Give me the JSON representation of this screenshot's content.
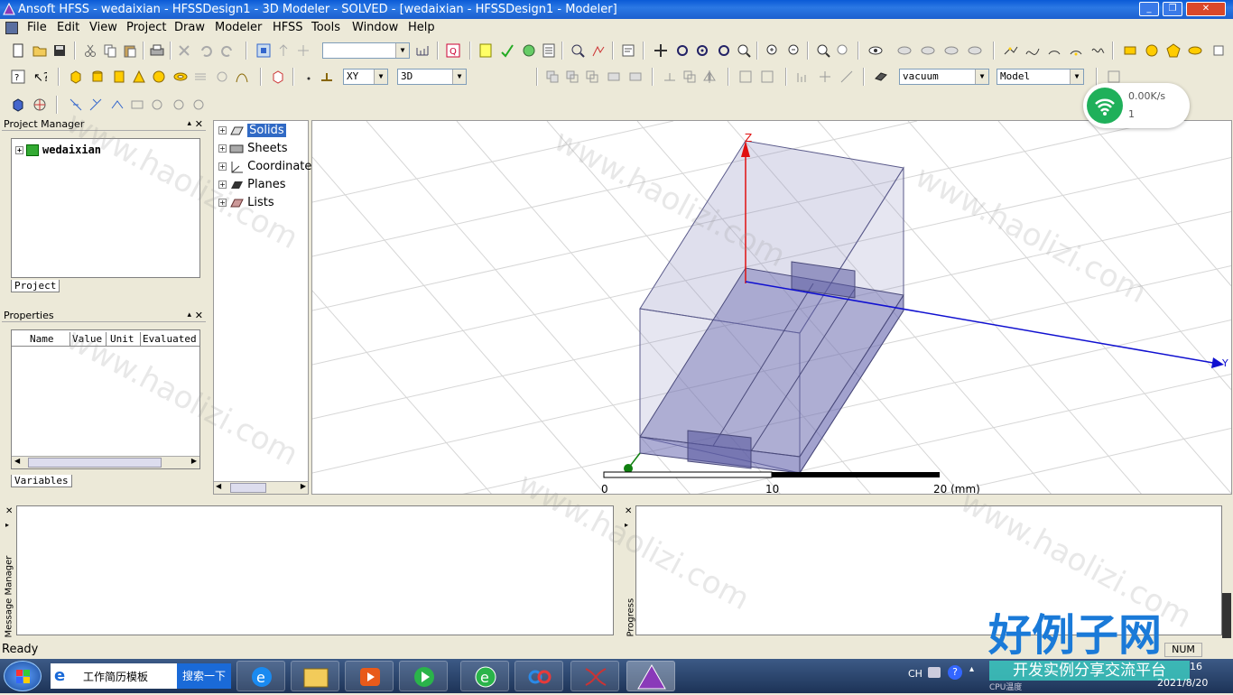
{
  "window": {
    "title": "Ansoft HFSS  - wedaixian - HFSSDesign1 - 3D Modeler - SOLVED - [wedaixian - HFSSDesign1 - Modeler]"
  },
  "menu": [
    "File",
    "Edit",
    "View",
    "Project",
    "Draw",
    "Modeler",
    "HFSS",
    "Tools",
    "Window",
    "Help"
  ],
  "toolbar": {
    "plane": "XY",
    "dim": "3D",
    "material": "vacuum",
    "model": "Model",
    "blank_combo": ""
  },
  "project_manager": {
    "title": "Project Manager",
    "project": "wedaixian",
    "tab": "Project"
  },
  "properties": {
    "title": "Properties",
    "columns": [
      "Name",
      "Value",
      "Unit",
      "Evaluated"
    ],
    "tab": "Variables"
  },
  "model_tree": [
    {
      "label": "Solids",
      "icon": "solids-icon",
      "selected": true
    },
    {
      "label": "Sheets",
      "icon": "sheets-icon",
      "selected": false
    },
    {
      "label": "Coordinate",
      "icon": "coordinate-icon",
      "selected": false
    },
    {
      "label": "Planes",
      "icon": "planes-icon",
      "selected": false
    },
    {
      "label": "Lists",
      "icon": "lists-icon",
      "selected": false
    }
  ],
  "viewport": {
    "axis_z": "Z",
    "axis_y": "Y",
    "scale_labels": [
      "0",
      "10",
      "20 (mm)"
    ]
  },
  "message_manager": {
    "label": "Message Manager"
  },
  "progress": {
    "label": "Progress"
  },
  "status": {
    "text": "Ready",
    "num": "NUM"
  },
  "network": {
    "speed": "0.00K/s",
    "count": "1"
  },
  "taskbar": {
    "search_text": "工作简历模板",
    "search_button": "搜索一下",
    "lang": "CH",
    "time": "16",
    "date": "2021/8/20",
    "extra": "CPU温度"
  },
  "watermark": {
    "brand": "好例子网",
    "slogan": "开发实例分享交流平台",
    "url": "www.haolizi.com"
  },
  "colors": {
    "title": "#1c5fcf",
    "box_fill": "#8c8cc0",
    "z_axis": "#e01010",
    "y_axis": "#1010d0",
    "wifi": "#1fb05a"
  }
}
